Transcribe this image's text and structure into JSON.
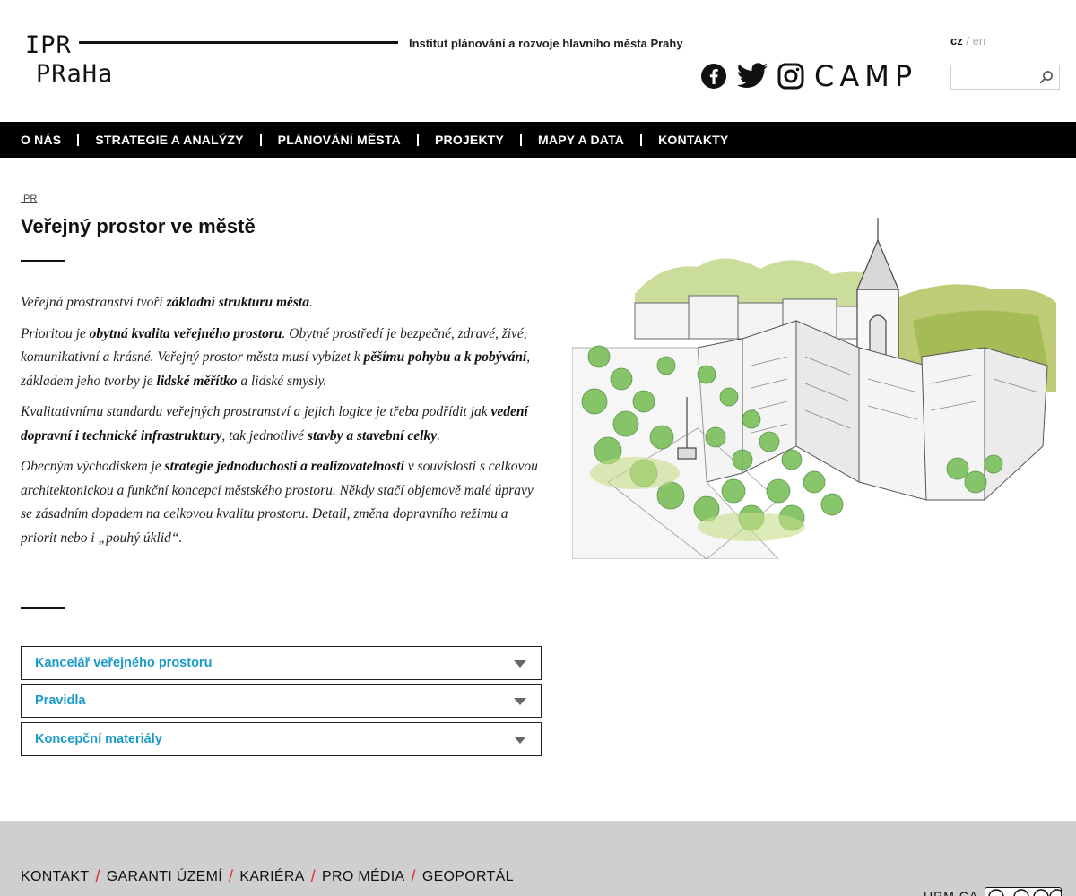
{
  "header": {
    "logo_line1": "IPR",
    "logo_line2": "PRaHa",
    "tagline": "Institut plánování a rozvoje hlavního města Prahy",
    "lang_active": "cz",
    "lang_separator": "/",
    "lang_other": "en",
    "camp_label": "CAMP",
    "search_placeholder": "",
    "social_icons": [
      "facebook-icon",
      "twitter-icon",
      "instagram-icon"
    ]
  },
  "nav": {
    "items": [
      "O NÁS",
      "STRATEGIE A ANALÝZY",
      "PLÁNOVÁNÍ MĚSTA",
      "PROJEKTY",
      "MAPY A DATA",
      "KONTAKTY"
    ]
  },
  "breadcrumb": "IPR",
  "page_title": "Veřejný prostor ve městě",
  "content": {
    "p1": [
      {
        "t": "Veřejná prostranství tvoří ",
        "b": false
      },
      {
        "t": "základní strukturu města",
        "b": true
      },
      {
        "t": ".",
        "b": false
      }
    ],
    "p2": [
      {
        "t": "Prioritou je ",
        "b": false
      },
      {
        "t": "obytná kvalita veřejného prostoru",
        "b": true
      },
      {
        "t": ". Obytné prostředí je bezpečné, zdravé, živé, komunikativní a krásné. Veřejný prostor města musí vybízet k ",
        "b": false
      },
      {
        "t": "pěšímu pohybu a k pobývání",
        "b": true
      },
      {
        "t": ", základem jeho tvorby je ",
        "b": false
      },
      {
        "t": "lidské měřítko",
        "b": true
      },
      {
        "t": " a lidské smysly.",
        "b": false
      }
    ],
    "p3": [
      {
        "t": "Kvalitativnímu standardu veřejných prostranství a jejich logice je třeba podřídit jak ",
        "b": false
      },
      {
        "t": "vedení dopravní i technické infrastruktury",
        "b": true
      },
      {
        "t": ", tak jednotlivé ",
        "b": false
      },
      {
        "t": "stavby a stavební celky",
        "b": true
      },
      {
        "t": ".",
        "b": false
      }
    ],
    "p4": [
      {
        "t": "Obecným východiskem je ",
        "b": false
      },
      {
        "t": "strategie jednoduchosti a realizovatelnosti",
        "b": true
      },
      {
        "t": " v souvislosti s celkovou architektonickou a funkční koncepcí městského prostoru. Někdy stačí objemově malé úpravy se zásadním dopadem na celkovou kvalitu prostoru. Detail, změna dopravního režimu a priorit nebo i „pouhý úklid“.",
        "b": false
      }
    ]
  },
  "accordion": {
    "items": [
      "Kancelář veřejného prostoru",
      "Pravidla",
      "Koncepční materiály"
    ]
  },
  "footer": {
    "links": [
      "KONTAKT",
      "GARANTI ÚZEMÍ",
      "KARIÉRA",
      "PRO MÉDIA",
      "GEOPORTÁL"
    ],
    "link_separator": "/",
    "urm_label": "URM CA"
  },
  "colors": {
    "accent_link": "#1a9bc9",
    "nav_bg": "#000000",
    "footer_bg": "#cfcfcf",
    "footer_separator": "#e0262b",
    "tree_green": "#7bbf5a",
    "hill_green": "#9cc04a"
  }
}
